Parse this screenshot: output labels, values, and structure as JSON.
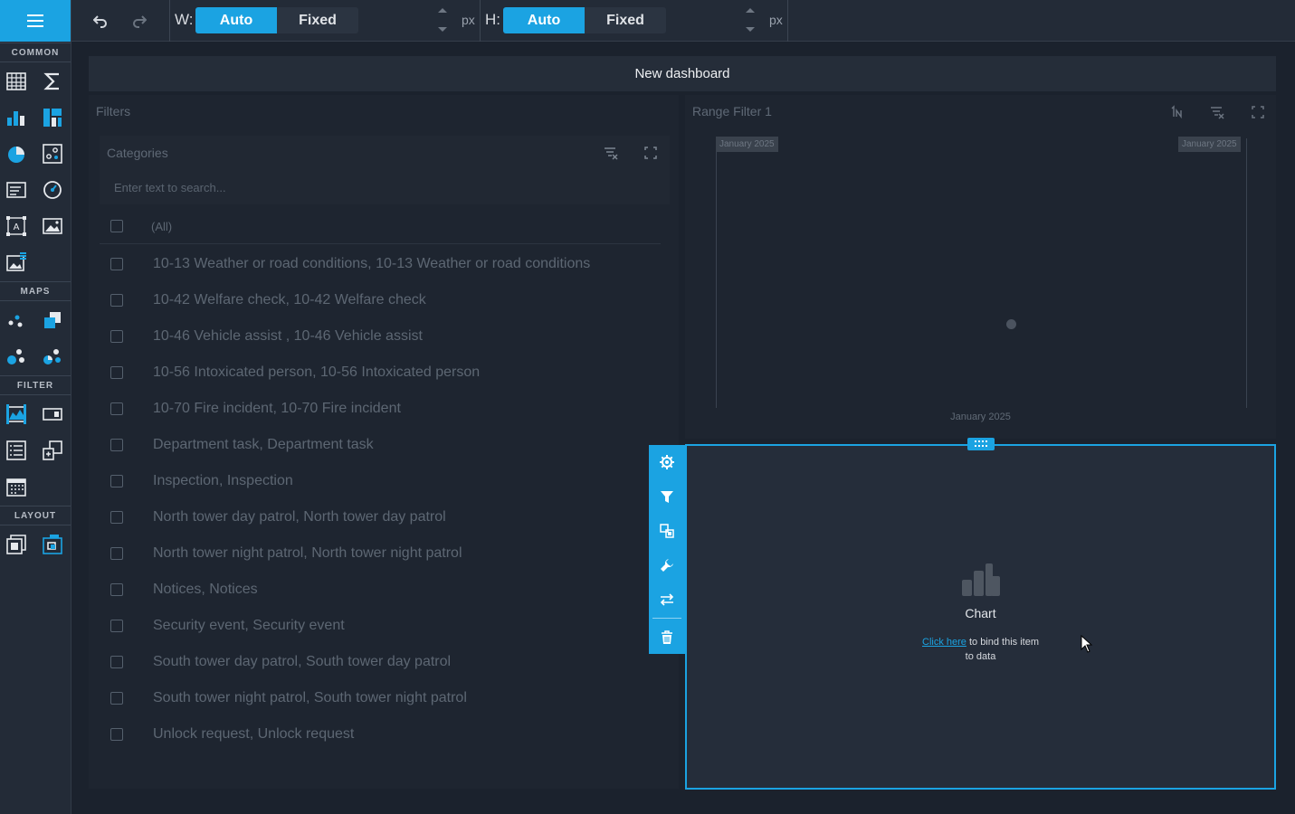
{
  "toolbox": {
    "menu_label": "",
    "sections": {
      "common": "COMMON",
      "maps": "MAPS",
      "filter": "FILTER",
      "layout": "LAYOUT"
    },
    "accent_color": "#1ba3e2",
    "items": [
      {
        "id": "grid",
        "icon": "grid-icon"
      },
      {
        "id": "card",
        "icon": "sigma-icon"
      },
      {
        "id": "chart",
        "icon": "bar-chart-icon"
      },
      {
        "id": "treemap",
        "icon": "treemap-icon"
      },
      {
        "id": "pie",
        "icon": "pie-chart-icon"
      },
      {
        "id": "scatter",
        "icon": "scatter-chart-icon"
      },
      {
        "id": "text",
        "icon": "text-box-icon"
      },
      {
        "id": "gauge",
        "icon": "gauge-icon"
      },
      {
        "id": "bound-image",
        "icon": "bound-image-icon"
      },
      {
        "id": "image",
        "icon": "image-icon"
      },
      {
        "id": "custom",
        "icon": "custom-item-icon"
      },
      {
        "id": "geo-point-map",
        "icon": "geo-point-map-icon"
      },
      {
        "id": "choropleth-map",
        "icon": "choropleth-map-icon"
      },
      {
        "id": "bubble-map",
        "icon": "bubble-map-icon"
      },
      {
        "id": "pie-map",
        "icon": "pie-map-icon"
      },
      {
        "id": "range-filter",
        "icon": "range-filter-icon"
      },
      {
        "id": "combo-box",
        "icon": "combo-box-icon"
      },
      {
        "id": "list-box",
        "icon": "list-box-icon"
      },
      {
        "id": "tree-view",
        "icon": "tree-view-icon"
      },
      {
        "id": "date-filter",
        "icon": "date-filter-icon"
      },
      {
        "id": "group",
        "icon": "group-icon"
      },
      {
        "id": "tab-container",
        "icon": "tab-container-icon"
      }
    ]
  },
  "topbar": {
    "undo_icon": "undo-icon",
    "redo_icon": "redo-icon",
    "width_label": "W:",
    "height_label": "H:",
    "auto_label": "Auto",
    "fixed_label": "Fixed",
    "unit": "px",
    "width_value": "",
    "height_value": "",
    "width_mode": "Auto",
    "height_mode": "Auto"
  },
  "dashboard": {
    "title": "New dashboard",
    "filters_group": {
      "title": "Filters",
      "categories": {
        "title": "Categories",
        "search_placeholder": "Enter text to search...",
        "all_label": "(All)",
        "items": [
          "10-13 Weather or road conditions, 10-13 Weather or road conditions",
          "10-42 Welfare check, 10-42 Welfare check",
          "10-46 Vehicle assist , 10-46 Vehicle assist",
          "10-56 Intoxicated person, 10-56 Intoxicated person",
          "10-70 Fire incident, 10-70 Fire incident",
          "Department task, Department task",
          "Inspection, Inspection",
          "North tower day patrol, North tower day patrol",
          "North tower night patrol, North tower night patrol",
          "Notices, Notices",
          "Security event, Security event",
          "South tower day patrol, South tower day patrol",
          "South tower night patrol, South tower night patrol",
          "Unlock request, Unlock request"
        ]
      }
    },
    "range_filter": {
      "title": "Range Filter 1",
      "start_tag": "January 2025",
      "end_tag": "January 2025",
      "axis_label": "January 2025"
    },
    "chart_item": {
      "placeholder_title": "Chart",
      "link_text": "Click here",
      "bind_text_1": " to bind this item",
      "bind_text_2": "to data"
    },
    "item_menu": [
      {
        "id": "options",
        "icon": "gear-icon"
      },
      {
        "id": "interactivity",
        "icon": "filter-icon"
      },
      {
        "id": "convert",
        "icon": "convert-icon"
      },
      {
        "id": "design",
        "icon": "wrench-icon"
      },
      {
        "id": "swap",
        "icon": "swap-arrows-icon"
      },
      {
        "id": "delete",
        "icon": "trash-icon"
      }
    ]
  }
}
